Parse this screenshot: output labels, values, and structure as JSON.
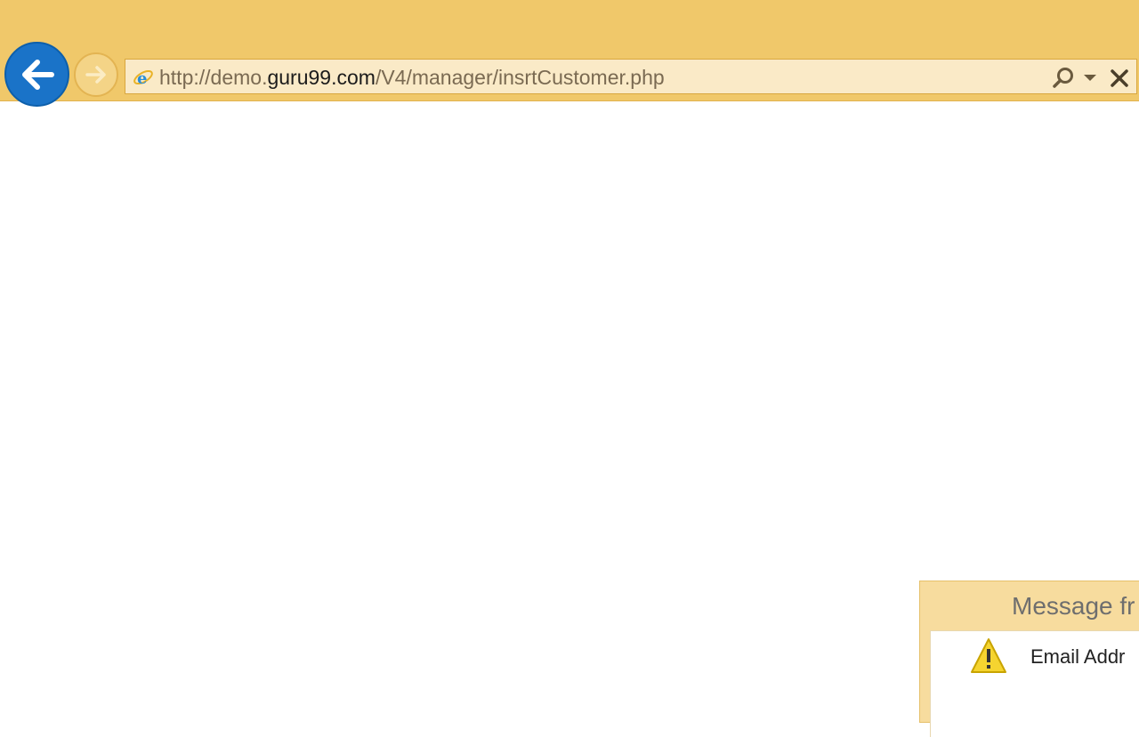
{
  "browser": {
    "url_prefix": "http://demo.",
    "url_domain": "guru99.com",
    "url_suffix": "/V4/manager/insrtCustomer.php",
    "colors": {
      "toolbar": "#f0c86a",
      "back_button": "#1a73c8",
      "address_bar": "#faeac7"
    },
    "icons": {
      "back": "arrow-left-icon",
      "forward": "arrow-right-icon",
      "site": "internet-explorer-icon",
      "search": "search-icon",
      "dropdown": "chevron-down-icon",
      "stop": "close-icon"
    }
  },
  "dialog": {
    "title": "Message fr",
    "message": "Email Addr",
    "icon": "warning-icon"
  }
}
